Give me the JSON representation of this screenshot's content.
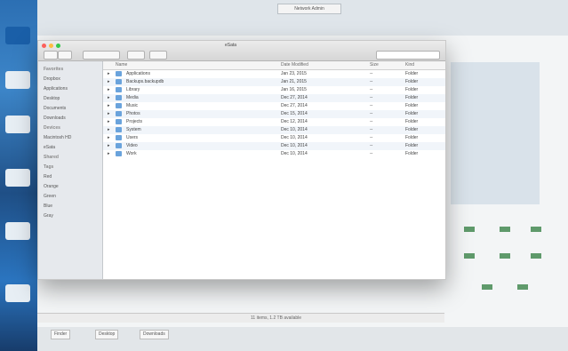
{
  "top": {
    "pill_label": "Network Admin"
  },
  "window": {
    "title": "eSata",
    "sidebar": [
      {
        "label": "Favorites",
        "head": true
      },
      {
        "label": "Dropbox"
      },
      {
        "label": "Applications"
      },
      {
        "label": "Desktop"
      },
      {
        "label": "Documents"
      },
      {
        "label": "Downloads"
      },
      {
        "label": "Devices",
        "head": true
      },
      {
        "label": "Macintosh HD"
      },
      {
        "label": "eSata"
      },
      {
        "label": "Shared",
        "head": true
      },
      {
        "label": "Tags",
        "head": true
      },
      {
        "label": "Red"
      },
      {
        "label": "Orange"
      },
      {
        "label": "Green"
      },
      {
        "label": "Blue"
      },
      {
        "label": "Gray"
      }
    ],
    "columns": {
      "name": "Name",
      "date": "Date Modified",
      "size": "Size",
      "kind": "Kind"
    },
    "rows": [
      {
        "name": "Applications",
        "date": "Jan 23, 2015",
        "size": "--",
        "kind": "Folder"
      },
      {
        "name": "Backups.backupdb",
        "date": "Jan 21, 2015",
        "size": "--",
        "kind": "Folder"
      },
      {
        "name": "Library",
        "date": "Jan 16, 2015",
        "size": "--",
        "kind": "Folder"
      },
      {
        "name": "Media",
        "date": "Dec 27, 2014",
        "size": "--",
        "kind": "Folder"
      },
      {
        "name": "Music",
        "date": "Dec 27, 2014",
        "size": "--",
        "kind": "Folder"
      },
      {
        "name": "Photos",
        "date": "Dec 15, 2014",
        "size": "--",
        "kind": "Folder"
      },
      {
        "name": "Projects",
        "date": "Dec 12, 2014",
        "size": "--",
        "kind": "Folder"
      },
      {
        "name": "System",
        "date": "Dec 10, 2014",
        "size": "--",
        "kind": "Folder"
      },
      {
        "name": "Users",
        "date": "Dec 10, 2014",
        "size": "--",
        "kind": "Folder"
      },
      {
        "name": "Video",
        "date": "Dec 10, 2014",
        "size": "--",
        "kind": "Folder"
      },
      {
        "name": "Work",
        "date": "Dec 10, 2014",
        "size": "--",
        "kind": "Folder"
      }
    ],
    "status": "11 items, 1.2 TB available"
  },
  "bottom": {
    "tabs": [
      "Finder",
      "Desktop",
      "Downloads"
    ]
  },
  "colors": {
    "accent": "#6aa3dc",
    "green": "#5f9a6b"
  }
}
